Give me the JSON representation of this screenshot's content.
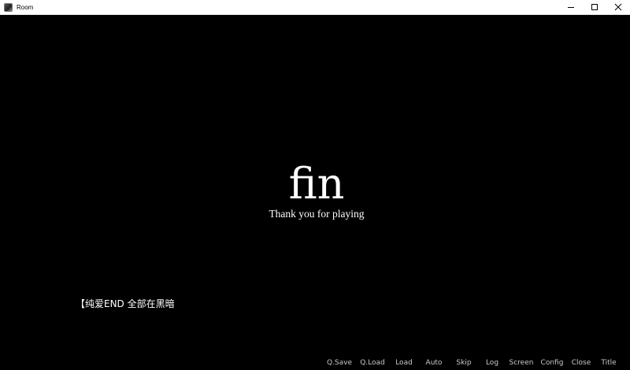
{
  "window": {
    "title": "Room"
  },
  "scene": {
    "fin": "fin",
    "thanks": "Thank you for playing",
    "ending_label": "【纯爱END 全部在黑暗"
  },
  "quick_menu": [
    {
      "label": "Q.Save",
      "name": "qsave-button"
    },
    {
      "label": "Q.Load",
      "name": "qload-button"
    },
    {
      "label": "Load",
      "name": "load-button"
    },
    {
      "label": "Auto",
      "name": "auto-button"
    },
    {
      "label": "Skip",
      "name": "skip-button"
    },
    {
      "label": "Log",
      "name": "log-button"
    },
    {
      "label": "Screen",
      "name": "screen-button"
    },
    {
      "label": "Config",
      "name": "config-button"
    },
    {
      "label": "Close",
      "name": "close-button"
    },
    {
      "label": "Title",
      "name": "title-button"
    }
  ],
  "colors": {
    "background": "#000000",
    "text": "#ffffff",
    "quick_menu_text": "#c9c9c9",
    "titlebar": "#ffffff"
  },
  "icons": {
    "app": "app-icon",
    "minimize": "minimize-icon",
    "maximize": "maximize-icon",
    "close": "close-icon"
  }
}
